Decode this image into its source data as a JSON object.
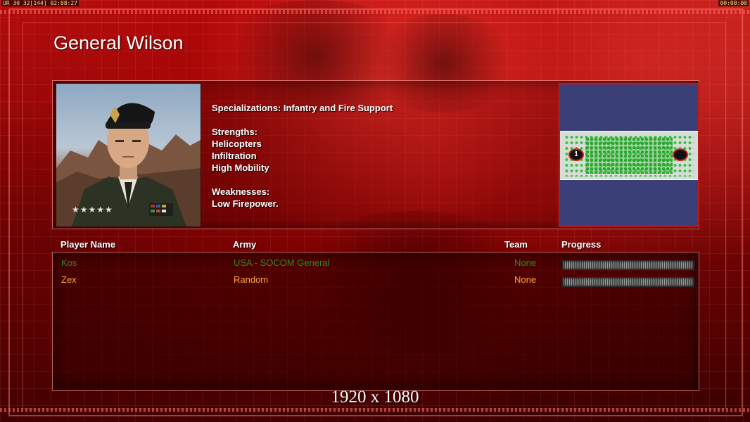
{
  "hud": {
    "left_text": "UR 30 32[144] 02:08:27",
    "right_text": "00:00:00"
  },
  "general": {
    "name": "General Wilson",
    "description": {
      "specializations": "Specializations: Infantry and Fire Support",
      "strengths_heading": "Strengths:",
      "strengths": [
        "Helicopters",
        "Infiltration",
        "High Mobility"
      ],
      "weaknesses_heading": "Weaknesses:",
      "weaknesses": [
        "Low Firepower."
      ]
    },
    "rank_stars": "★★★★★"
  },
  "map": {
    "start_positions": [
      "1",
      ""
    ],
    "colors": {
      "water": "#3b3f78",
      "land": "#d5ddd6",
      "trees": "#39c23e",
      "border": "#c01818"
    }
  },
  "table": {
    "headers": {
      "player_name": "Player Name",
      "army": "Army",
      "team": "Team",
      "progress": "Progress"
    },
    "rows": [
      {
        "name": "Kos",
        "army": "USA - SOCOM General",
        "team": "None",
        "progress": 1.0,
        "color": "#2a8a1e"
      },
      {
        "name": "Zex",
        "army": "Random",
        "team": "None",
        "progress": 1.0,
        "color": "#ffa53a"
      }
    ]
  },
  "footer": {
    "resolution": "1920 x 1080"
  },
  "theme": {
    "accent": "#d01818",
    "text": "#ffffff"
  }
}
